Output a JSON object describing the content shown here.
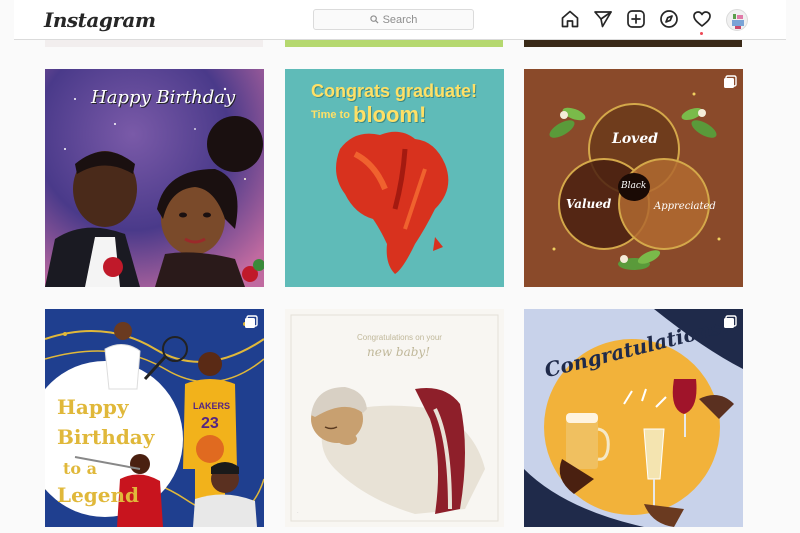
{
  "app": {
    "logo": "Instagram"
  },
  "search": {
    "placeholder": "Search"
  },
  "nav": {
    "icons": [
      "home-icon",
      "direct-icon",
      "new-post-icon",
      "explore-icon",
      "activity-icon",
      "profile-avatar"
    ]
  },
  "posts": [
    {
      "heading": "Happy Birthday"
    },
    {
      "line1": "Congrats graduate!",
      "line2a": "Time to",
      "line2b": "bloom!"
    },
    {
      "top": "Loved",
      "left": "Valued",
      "right": "Appreciated",
      "center": "Black"
    },
    {
      "line1": "Happy",
      "line2": "Birthday",
      "line3": "to a",
      "line4": "Legend",
      "jersey_team": "LAKERS",
      "jersey_number": "23"
    },
    {
      "line1": "Congratulations on your",
      "line2": "new baby!"
    },
    {
      "heading": "Congratulations!"
    }
  ],
  "colors": {
    "accent": "#ed4956",
    "border": "#dbdbdb",
    "text": "#262626",
    "muted": "#8e8e8e"
  }
}
